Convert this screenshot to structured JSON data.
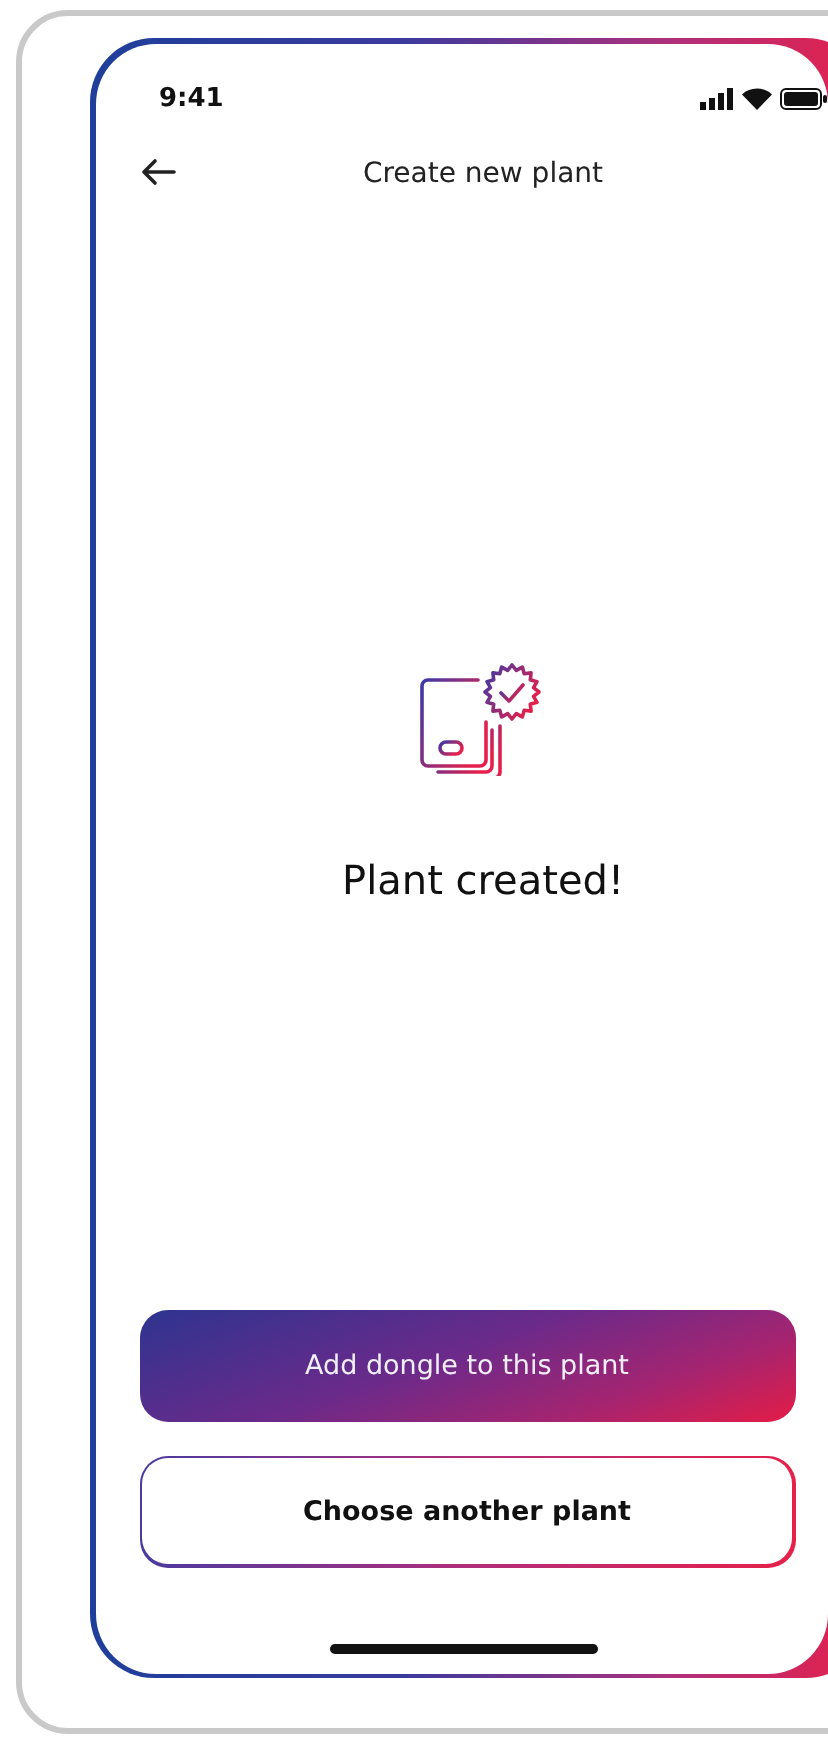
{
  "status_bar": {
    "time": "9:41"
  },
  "header": {
    "title": "Create new plant"
  },
  "message": "Plant created!",
  "buttons": [
    {
      "label": "Add dongle to this plant",
      "kind": "primary"
    },
    {
      "label": "Choose another plant",
      "kind": "outline"
    }
  ]
}
